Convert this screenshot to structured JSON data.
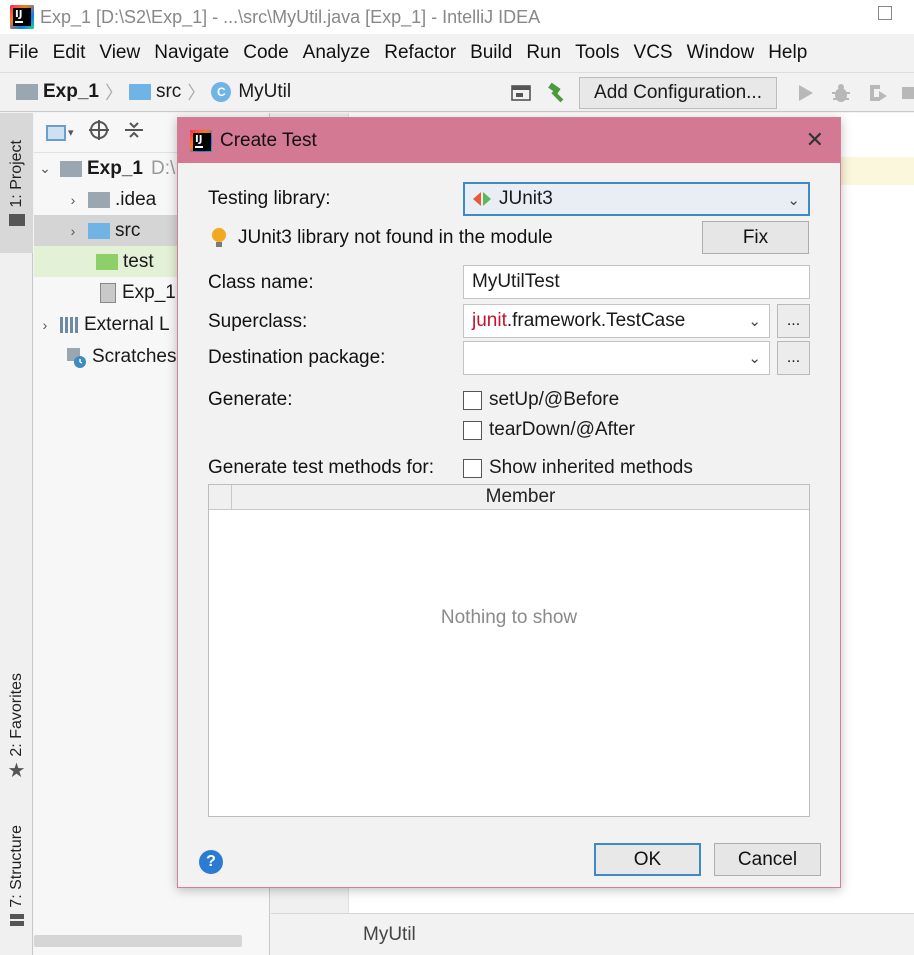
{
  "window": {
    "title": "Exp_1 [D:\\S2\\Exp_1] - ...\\src\\MyUtil.java [Exp_1] - IntelliJ IDEA"
  },
  "menu": [
    "File",
    "Edit",
    "View",
    "Navigate",
    "Code",
    "Analyze",
    "Refactor",
    "Build",
    "Run",
    "Tools",
    "VCS",
    "Window",
    "Help"
  ],
  "breadcrumb": {
    "project": "Exp_1",
    "folder": "src",
    "file": "MyUtil"
  },
  "toolbar": {
    "add_configuration": "Add Configuration..."
  },
  "left_tabs": {
    "project": "1: Project",
    "favorites": "2: Favorites",
    "structure": "7: Structure"
  },
  "tree": {
    "root": "Exp_1",
    "root_path": "D:\\",
    "idea": ".idea",
    "src": "src",
    "test": "test",
    "iml": "Exp_1.",
    "external": "External L",
    "scratches": "Scratches"
  },
  "editor": {
    "footer": "MyUtil"
  },
  "dialog": {
    "title": "Create Test",
    "testing_library_label": "Testing library:",
    "testing_library_value": "JUnit3",
    "warning": "JUnit3 library not found in the module",
    "fix_button": "Fix",
    "class_name_label": "Class name:",
    "class_name_value": "MyUtilTest",
    "superclass_label": "Superclass:",
    "superclass_prefix": "junit",
    "superclass_rest": ".framework.TestCase",
    "destination_label": "Destination package:",
    "destination_value": "",
    "ellipsis": "...",
    "generate_label": "Generate:",
    "setup_label": "setUp/@Before",
    "teardown_label": "tearDown/@After",
    "generate_for_label": "Generate test methods for:",
    "show_inherited_label": "Show inherited methods",
    "member_header": "Member",
    "empty_text": "Nothing to show",
    "help": "?",
    "ok_button": "OK",
    "cancel_button": "Cancel"
  },
  "colors": {
    "dialog_header": "#d47993",
    "focus_blue": "#3d8ac4",
    "error_red": "#c8102e",
    "test_folder_bg": "#e3f1d6"
  }
}
